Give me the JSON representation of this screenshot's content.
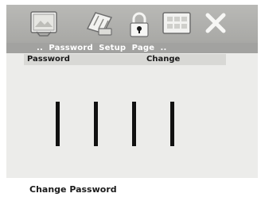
{
  "icon_bar": {
    "icons": [
      "picture-settings-icon",
      "audio-settings-icon",
      "lock-icon",
      "grid-settings-icon",
      "close-icon"
    ],
    "active": "lock-icon"
  },
  "menu": {
    "path_text": "..  Password  Setup  Page  .."
  },
  "table_header": {
    "left_label": "Password",
    "right_label": "Change"
  },
  "password": {
    "digit_count": 4
  },
  "status_text": "Change  Password",
  "colors": {
    "panel_bg": "#ececea",
    "icon_bar_bg": "#b3b3b0",
    "menu_bar_bg": "#a2a2a0",
    "header_row_bg": "#d8d8d5",
    "text": "#1a1a1a",
    "digit": "#111111"
  }
}
